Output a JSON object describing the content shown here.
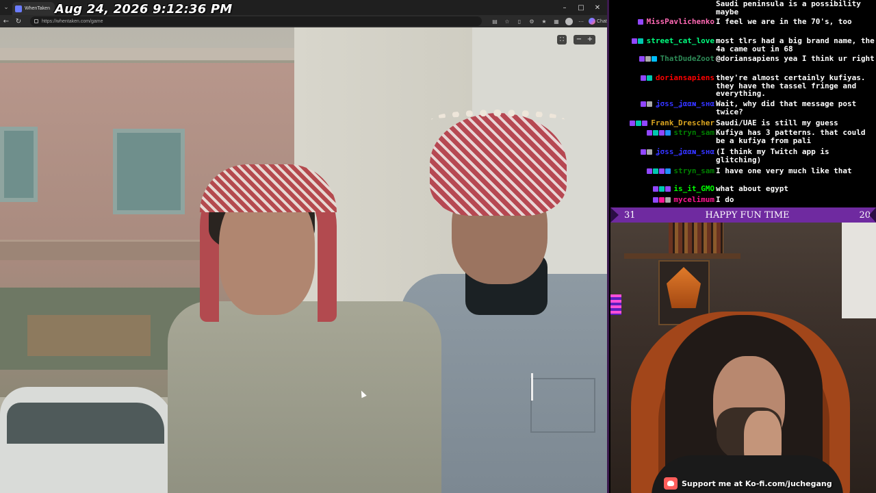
{
  "browser": {
    "tab_title": "WhenTaken",
    "url": "https://whentaken.com/game",
    "chat_label": "Chat",
    "controls": {
      "minimize": "–",
      "maximize": "□",
      "close": "✕",
      "back": "←",
      "reload": "↻",
      "menu": "⌄"
    }
  },
  "overlay": {
    "timestamp": "Aug 24, 2026 9:12:36 PM"
  },
  "game": {
    "fullscreen": "⛶",
    "zoom_out": "−",
    "zoom_in": "+"
  },
  "chat": {
    "lines": [
      {
        "user": "",
        "text": "Saudi peninsula is a possibility maybe",
        "color": "#ffffff",
        "badges": []
      },
      {
        "user": "MissPavlichenko",
        "text": "I feel we are in the 70's, too",
        "color": "#ff69b4",
        "badges": [
          "#9147ff"
        ]
      },
      {
        "user": "street_cat_love",
        "text": "most tlrs had a big brand name, the 4a came out in 68",
        "color": "#00ff7f",
        "badges": [
          "#9147ff",
          "#00c8af"
        ]
      },
      {
        "user": "ThatDudeZoot",
        "text": "@doriansapiens yea I think ur right",
        "color": "#2e8b57",
        "badges": [
          "#9147ff",
          "#aaaaaa",
          "#00bfff"
        ]
      },
      {
        "user": "doriansapiens",
        "text": "they're almost certainly kufiyas. they have the tassel fringe and everything.",
        "color": "#ff0000",
        "badges": [
          "#9147ff",
          "#00c8af"
        ]
      },
      {
        "user": "ʝσѕѕ_ʝααɴ_ѕнα",
        "text": "Wait, why did that message post twice?",
        "color": "#3333ff",
        "badges": [
          "#9147ff",
          "#aaaaaa"
        ]
      },
      {
        "user": "Frank_Drescher",
        "text": "Saudi/UAE is still my guess",
        "color": "#daa520",
        "badges": [
          "#9147ff",
          "#00c8af",
          "#9147ff"
        ]
      },
      {
        "user": "stryn_sam",
        "text": "Kufiya has 3 patterns. that could be a kufiya from pali",
        "color": "#008000",
        "badges": [
          "#9147ff",
          "#00c8af",
          "#9147ff",
          "#1e90ff"
        ]
      },
      {
        "user": "ʝσѕѕ_ʝααɴ_ѕнα",
        "text": "(I think my Twitch app is glitching)",
        "color": "#3333ff",
        "badges": [
          "#9147ff",
          "#aaaaaa"
        ]
      },
      {
        "user": "stryn_sam",
        "text": "I have one very much like that",
        "color": "#008000",
        "badges": [
          "#9147ff",
          "#00c8af",
          "#9147ff",
          "#1e90ff"
        ]
      },
      {
        "user": "is_it_GMO",
        "text": "what about egypt",
        "color": "#00ff00",
        "badges": [
          "#9147ff",
          "#00c8af",
          "#9147ff"
        ]
      },
      {
        "user": "mycelimum",
        "text": "I do",
        "color": "#ff1493",
        "badges": [
          "#9147ff",
          "#ff1493",
          "#aaaaaa"
        ]
      }
    ]
  },
  "stream": {
    "banner_left": "31",
    "banner_title": "HAPPY FUN TIME",
    "banner_right": "20",
    "kofi_text": "Support me at Ko-fi.com/juchegang"
  }
}
